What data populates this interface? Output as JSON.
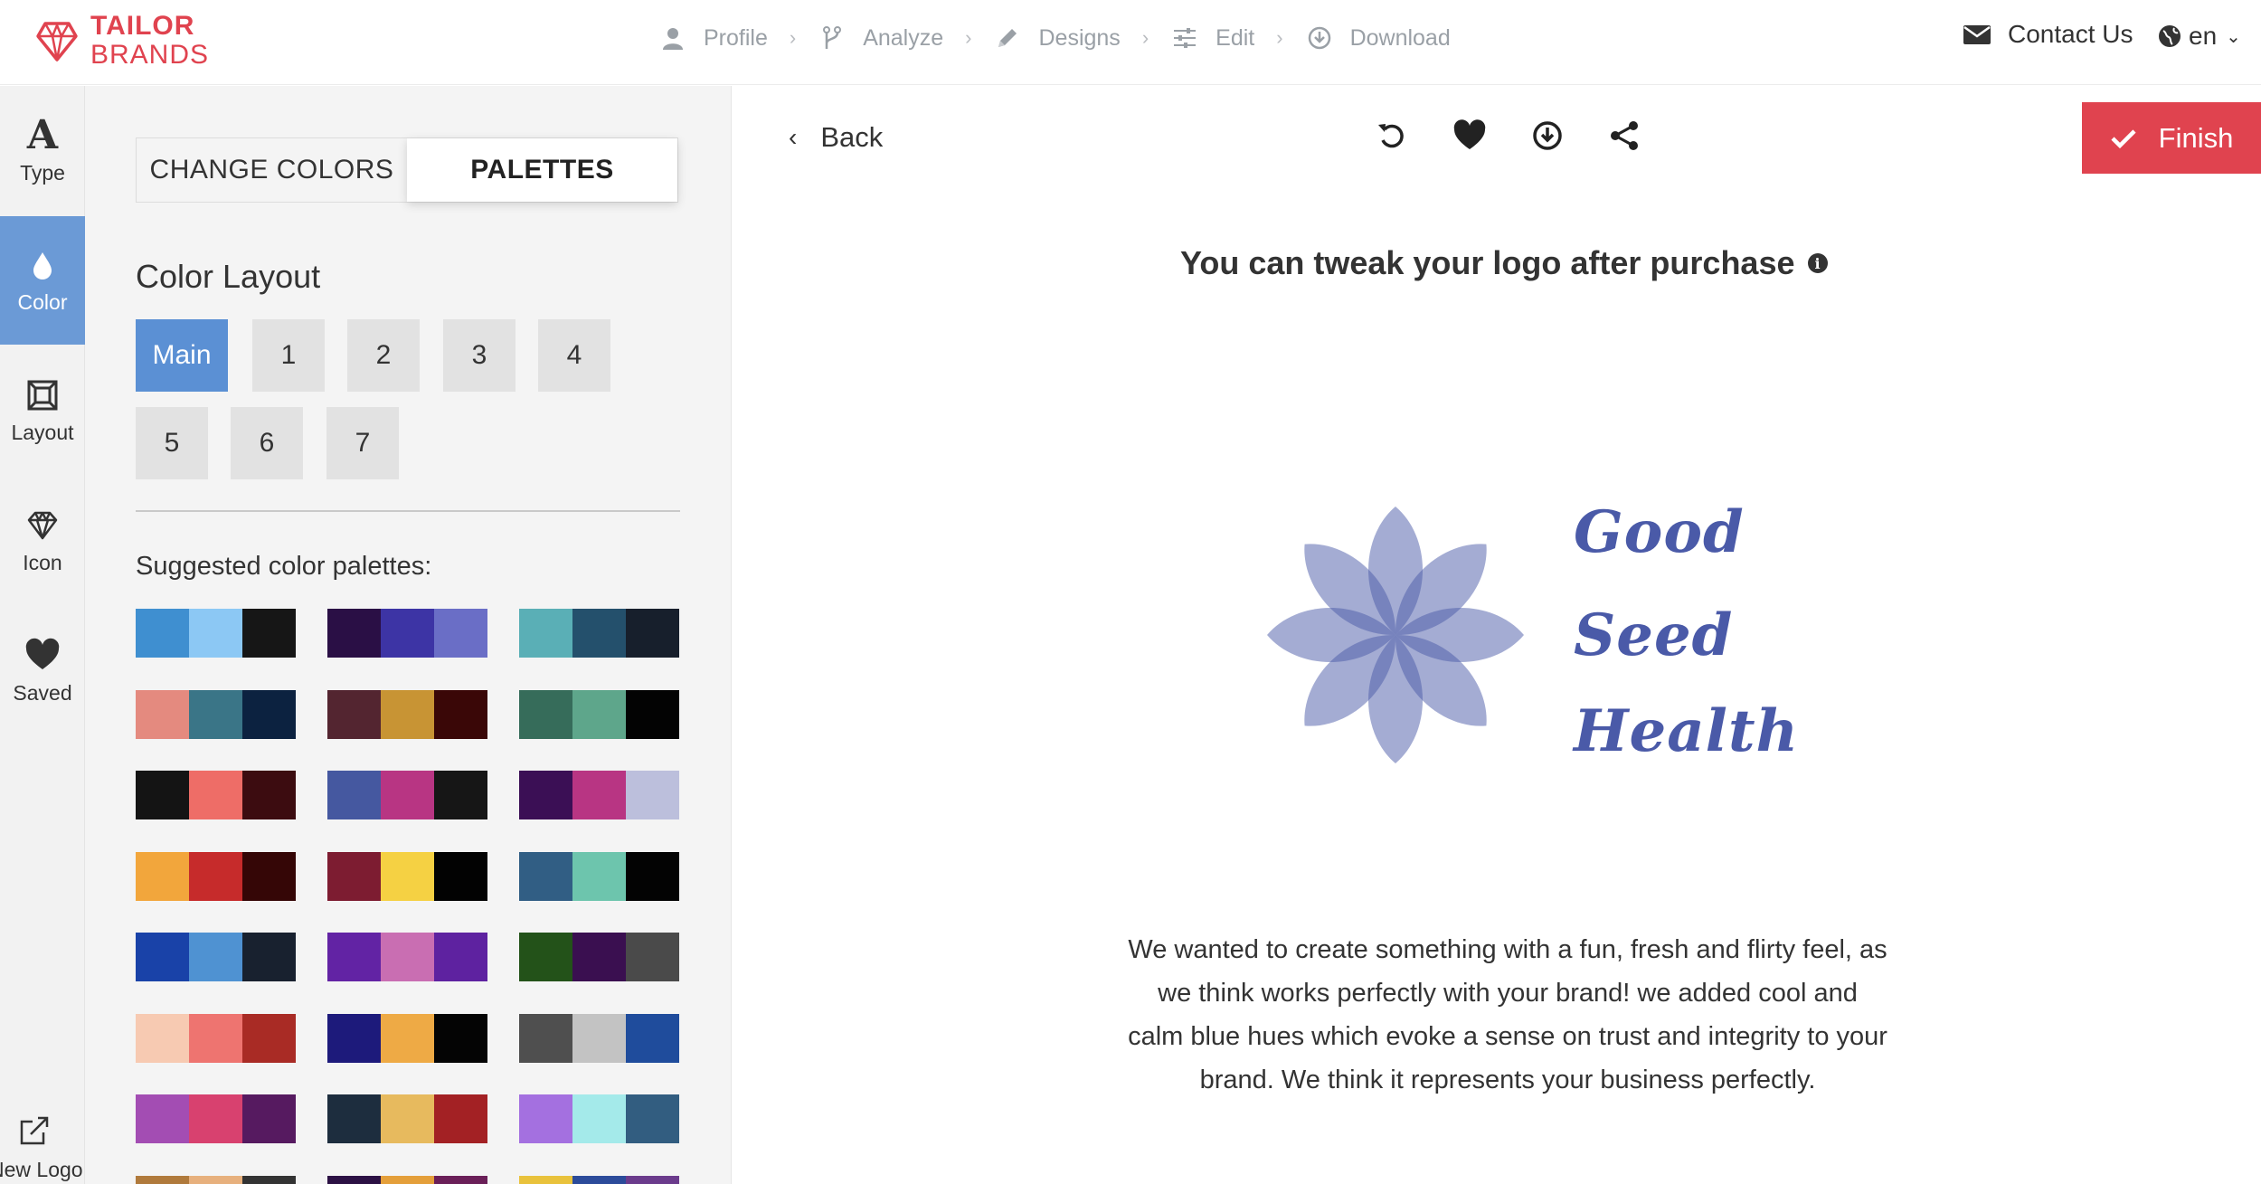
{
  "header": {
    "brand_line1": "TAILOR",
    "brand_line2": "BRANDS",
    "steps": [
      {
        "label": "Profile",
        "icon": "user-icon"
      },
      {
        "label": "Analyze",
        "icon": "branch-icon"
      },
      {
        "label": "Designs",
        "icon": "pencil-icon"
      },
      {
        "label": "Edit",
        "icon": "sliders-icon"
      },
      {
        "label": "Download",
        "icon": "download-icon"
      }
    ],
    "contact_label": "Contact Us",
    "language": "en"
  },
  "rail": {
    "items": [
      {
        "label": "Type",
        "icon": "type-icon"
      },
      {
        "label": "Color",
        "icon": "drop-icon",
        "active": true
      },
      {
        "label": "Layout",
        "icon": "layout-icon"
      },
      {
        "label": "Icon",
        "icon": "diamond-icon"
      },
      {
        "label": "Saved",
        "icon": "heart-icon"
      }
    ],
    "new_logo_label": "New Logo"
  },
  "panel": {
    "tabs": {
      "change_colors": "CHANGE COLORS",
      "palettes": "PALETTES"
    },
    "color_layout_title": "Color Layout",
    "layout_buttons": [
      "Main",
      "1",
      "2",
      "3",
      "4",
      "5",
      "6",
      "7"
    ],
    "suggested_title": "Suggested color palettes:",
    "palettes": [
      [
        "#3f8fd0",
        "#8cc8f4",
        "#161616"
      ],
      [
        "#2a0f45",
        "#3d34a5",
        "#6a6ec6"
      ],
      [
        "#5aafb6",
        "#24506c",
        "#171f2c"
      ],
      [
        "#e48a7f",
        "#3a7587",
        "#0c2240"
      ],
      [
        "#532530",
        "#c89434",
        "#3a0707"
      ],
      [
        "#366c5a",
        "#5ea68b",
        "#030303"
      ],
      [
        "#141414",
        "#ee6d67",
        "#3c0c10"
      ],
      [
        "#4558a0",
        "#b83583",
        "#161616"
      ],
      [
        "#3b0f55",
        "#b83583",
        "#bcbfdc"
      ],
      [
        "#f2a63c",
        "#c62b2b",
        "#350606"
      ],
      [
        "#7d1c31",
        "#f5d143",
        "#020202"
      ],
      [
        "#315e84",
        "#6dc5ad",
        "#030303"
      ],
      [
        "#1942a8",
        "#4f92d2",
        "#18212f"
      ],
      [
        "#6223a4",
        "#c96eb2",
        "#5e22a0"
      ],
      [
        "#235219",
        "#3a0f50",
        "#4a4a4a"
      ],
      [
        "#f7cab2",
        "#ee7470",
        "#a92b25"
      ],
      [
        "#1d1a7b",
        "#eeaa45",
        "#040404"
      ],
      [
        "#4f4f4f",
        "#c3c3c3",
        "#1f4c9c"
      ],
      [
        "#a34db3",
        "#d8416f",
        "#561a60"
      ],
      [
        "#1d2d3e",
        "#e7ba5e",
        "#a32124"
      ],
      [
        "#a470e0",
        "#a4eaea",
        "#325d80"
      ],
      [
        "#b07a3c",
        "#e7b07d",
        "#333333"
      ],
      [
        "#2c1144",
        "#e49f3a",
        "#6a1f58"
      ],
      [
        "#e9c23c",
        "#2c4b9a",
        "#6b3b8c"
      ]
    ]
  },
  "main": {
    "back_label": "Back",
    "tools": [
      "undo-icon",
      "heart-icon",
      "download-icon",
      "share-icon"
    ],
    "finish_label": "Finish",
    "tweak_text": "You can tweak your logo after purchase",
    "logo_words": [
      "Good",
      "Seed",
      "Health"
    ],
    "logo_color": "#4a5aa8",
    "description": "We wanted to create something with a fun, fresh and flirty feel, as we think works perfectly with your brand! we added cool and calm blue hues which evoke a sense on trust and integrity to your brand. We think it represents your business perfectly."
  },
  "colors": {
    "brand_red": "#e0434f",
    "active_blue": "#5b90d4"
  }
}
